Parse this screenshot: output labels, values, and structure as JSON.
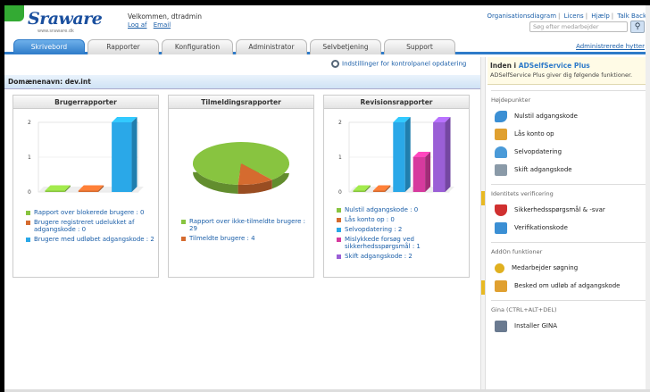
{
  "header": {
    "logo": "Sraware",
    "logo_sub": "www.sraware.dk",
    "welcome": "Velkommen, dtradmin",
    "logout": "Log af",
    "email": "Email",
    "links": [
      "Organisationsdiagram",
      "Licens",
      "Hjælp",
      "Talk Back"
    ],
    "search_placeholder": "Søg efter medarbejder"
  },
  "tabs": [
    "Skrivebord",
    "Rapporter",
    "Konfiguration",
    "Administrator",
    "Selvbetjening",
    "Support"
  ],
  "tab_right": "Administrerede hytter",
  "toolbar": {
    "refresh": "Indstillinger for kontrolpanel opdatering"
  },
  "domain": "Domænenavn: dev.int",
  "panels": [
    {
      "title": "Brugerrapporter",
      "chart_data": {
        "type": "bar",
        "categories": [
          "Rapport over blokerede brugere",
          "Brugere registreret udelukket af adgangskode",
          "Brugere med udløbet adgangskode"
        ],
        "values": [
          0,
          0,
          2
        ],
        "ylim": [
          0,
          2
        ],
        "colors": [
          "#88c440",
          "#d56b2f",
          "#2aa8e8"
        ]
      },
      "legend": [
        "Rapport over blokerede brugere : 0",
        "Brugere registreret udelukket af adgangskode : 0",
        "Brugere med udløbet adgangskode : 2"
      ],
      "yticks": [
        "2",
        "1",
        "0"
      ]
    },
    {
      "title": "Tilmeldingsrapporter",
      "chart_data": {
        "type": "pie",
        "categories": [
          "Rapport over ikke-tilmeldte brugere",
          "Tilmeldte brugere"
        ],
        "values": [
          29,
          4
        ],
        "colors": [
          "#88c440",
          "#d56b2f"
        ]
      },
      "legend": [
        "Rapport over ikke-tilmeldte brugere : 29",
        "Tilmeldte brugere : 4"
      ]
    },
    {
      "title": "Revisionsrapporter",
      "chart_data": {
        "type": "bar",
        "categories": [
          "Nulstil adgangskode",
          "Lås konto op",
          "Selvopdatering",
          "Mislykkede forsøg ved sikkerhedsspørgsmål",
          "Skift adgangskode"
        ],
        "values": [
          0,
          0,
          2,
          1,
          2
        ],
        "ylim": [
          0,
          2
        ],
        "colors": [
          "#88c440",
          "#d56b2f",
          "#2aa8e8",
          "#d63a9e",
          "#9a5fd6"
        ]
      },
      "legend": [
        "Nulstil adgangskode : 0",
        "Lås konto op : 0",
        "Selvopdatering : 2",
        "Mislykkede forsøg ved sikkerhedsspørgsmål : 1",
        "Skift adgangskode : 2"
      ],
      "yticks": [
        "2",
        "1",
        "0"
      ]
    }
  ],
  "sidebar": {
    "title_prefix": "Inden i",
    "title_link": "ADSelfService Plus",
    "desc": "ADSelfService Plus giver dig følgende funktioner.",
    "sections": [
      {
        "title": "Højdepunkter",
        "items": [
          {
            "label": "Nulstil adgangskode",
            "icon": "key-icon",
            "color": "#3b8fd4"
          },
          {
            "label": "Lås konto op",
            "icon": "lock-icon",
            "color": "#e0a030"
          },
          {
            "label": "Selvopdatering",
            "icon": "user-icon",
            "color": "#4a9ad8"
          },
          {
            "label": "Skift adgangskode",
            "icon": "printer-icon",
            "color": "#8a9aa8"
          }
        ]
      },
      {
        "title": "Identitets verificering",
        "items": [
          {
            "label": "Sikkerhedsspørgsmål & -svar",
            "icon": "shield-icon",
            "color": "#d03030"
          },
          {
            "label": "Verifikationskode",
            "icon": "phone-icon",
            "color": "#3b8fd4"
          }
        ]
      },
      {
        "title": "AddOn funktioner",
        "items": [
          {
            "label": "Medarbejder søgning",
            "icon": "search-icon",
            "color": "#e0b020"
          },
          {
            "label": "Besked om udløb af adgangskode",
            "icon": "mail-icon",
            "color": "#e0a030"
          }
        ]
      },
      {
        "title": "Gina (CTRL+ALT+DEL)",
        "items": [
          {
            "label": "Installer GINA",
            "icon": "computer-icon",
            "color": "#6a7a90"
          }
        ]
      }
    ]
  }
}
